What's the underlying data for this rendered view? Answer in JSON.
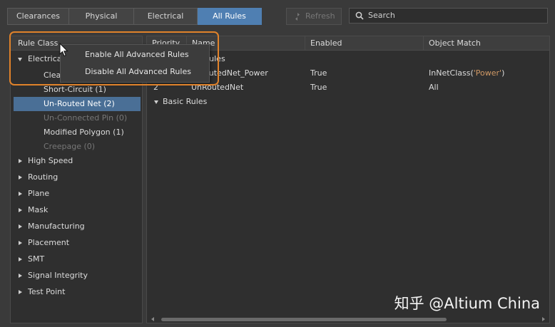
{
  "tabs": [
    {
      "label": "Clearances"
    },
    {
      "label": "Physical"
    },
    {
      "label": "Electrical"
    },
    {
      "label": "All Rules"
    }
  ],
  "toolbar": {
    "refresh_label": "Refresh",
    "search_placeholder": "Search"
  },
  "tree": {
    "header": "Rule Class",
    "electrical": {
      "label": "Electrica",
      "children": [
        {
          "label": "Clea"
        },
        {
          "label": "Short-Circuit (1)"
        },
        {
          "label": "Un-Routed Net (2)"
        },
        {
          "label": "Un-Connected Pin (0)"
        },
        {
          "label": "Modified Polygon (1)"
        },
        {
          "label": "Creepage (0)"
        }
      ]
    },
    "classes": [
      {
        "label": "High Speed"
      },
      {
        "label": "Routing"
      },
      {
        "label": "Plane"
      },
      {
        "label": "Mask"
      },
      {
        "label": "Manufacturing"
      },
      {
        "label": "Placement"
      },
      {
        "label": "SMT"
      },
      {
        "label": "Signal Integrity"
      },
      {
        "label": "Test Point"
      }
    ]
  },
  "grid": {
    "columns": [
      "Priority",
      "Name",
      "Enabled",
      "Object Match"
    ],
    "group_advanced": "Rules",
    "rows": [
      {
        "priority": "",
        "name": "outedNet_Power",
        "enabled": "True",
        "match_pre": "InNetClass(",
        "match_q": "'Power'",
        "match_post": ")"
      },
      {
        "priority": "2",
        "name": "UnRoutedNet",
        "enabled": "True",
        "match_pre": "All",
        "match_q": "",
        "match_post": ""
      }
    ],
    "group_basic": "Basic Rules"
  },
  "context_menu": {
    "items": [
      {
        "label": "Enable All Advanced Rules"
      },
      {
        "label": "Disable All Advanced Rules"
      }
    ]
  },
  "watermark": "知乎 @Altium China",
  "colors": {
    "accent": "#4f7fb2",
    "highlight": "#e0822a",
    "selection": "#4a6f96"
  }
}
